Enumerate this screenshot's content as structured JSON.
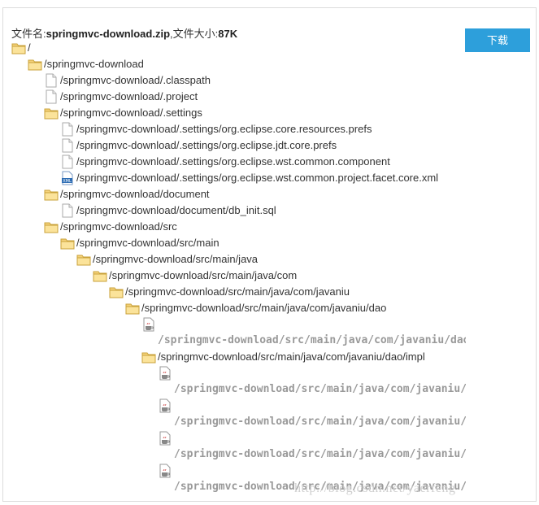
{
  "header": {
    "filename_label": "文件名:",
    "filename": "springmvc-download.zip",
    "size_label": ",文件大小:",
    "size": "87K"
  },
  "download_button": "下载",
  "tree": [
    {
      "label": "/",
      "type": "folder"
    },
    {
      "label": "/springmvc-download",
      "type": "folder"
    },
    {
      "label": "/springmvc-download/.classpath",
      "type": "file"
    },
    {
      "label": "/springmvc-download/.project",
      "type": "file"
    },
    {
      "label": "/springmvc-download/.settings",
      "type": "folder"
    },
    {
      "label": "/springmvc-download/.settings/org.eclipse.core.resources.prefs",
      "type": "file"
    },
    {
      "label": "/springmvc-download/.settings/org.eclipse.jdt.core.prefs",
      "type": "file"
    },
    {
      "label": "/springmvc-download/.settings/org.eclipse.wst.common.component",
      "type": "file"
    },
    {
      "label": "/springmvc-download/.settings/org.eclipse.wst.common.project.facet.core.xml",
      "type": "xml"
    },
    {
      "label": "/springmvc-download/document",
      "type": "folder"
    },
    {
      "label": "/springmvc-download/document/db_init.sql",
      "type": "file"
    },
    {
      "label": "/springmvc-download/src",
      "type": "folder"
    },
    {
      "label": "/springmvc-download/src/main",
      "type": "folder"
    },
    {
      "label": "/springmvc-download/src/main/java",
      "type": "folder"
    },
    {
      "label": "/springmvc-download/src/main/java/com",
      "type": "folder"
    },
    {
      "label": "/springmvc-download/src/main/java/com/javaniu",
      "type": "folder"
    },
    {
      "label": "/springmvc-download/src/main/java/com/javaniu/dao",
      "type": "folder"
    },
    {
      "label": "/springmvc-download/src/main/java/com/javaniu/dao/",
      "type": "java"
    },
    {
      "label": "/springmvc-download/src/main/java/com/javaniu/dao/impl",
      "type": "folder"
    },
    {
      "label": "/springmvc-download/src/main/java/com/javaniu/d",
      "type": "java"
    },
    {
      "label": "/springmvc-download/src/main/java/com/javaniu/d",
      "type": "java"
    },
    {
      "label": "/springmvc-download/src/main/java/com/javaniu/d",
      "type": "java"
    },
    {
      "label": "/springmvc-download/src/main/java/com/javaniu/d",
      "type": "java"
    }
  ],
  "watermark": "http://blog.csdn.net/yaerfeng"
}
